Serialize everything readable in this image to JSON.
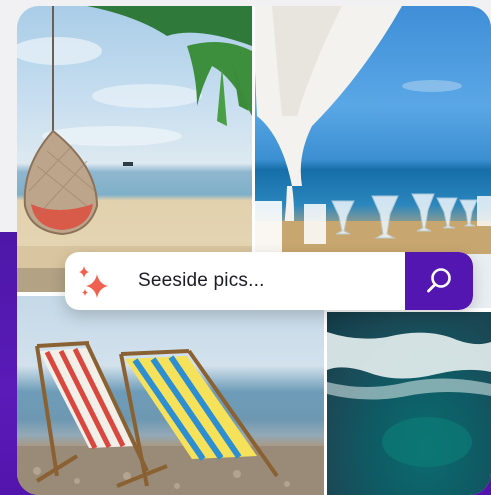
{
  "search": {
    "placeholder": "Seeside pics..."
  },
  "colors": {
    "accent": "#5416b0",
    "backdrop": "#4d17a8",
    "sparkle": "#f0624f"
  },
  "icons": {
    "sparkle": "sparkle-icon",
    "search": "search-icon"
  },
  "collage": {
    "images": [
      {
        "subject": "hanging-chair-beach"
      },
      {
        "subject": "beach-cabana-glasses"
      },
      {
        "subject": "beach-deck-chairs"
      },
      {
        "subject": "aerial-ocean-waves"
      }
    ]
  }
}
